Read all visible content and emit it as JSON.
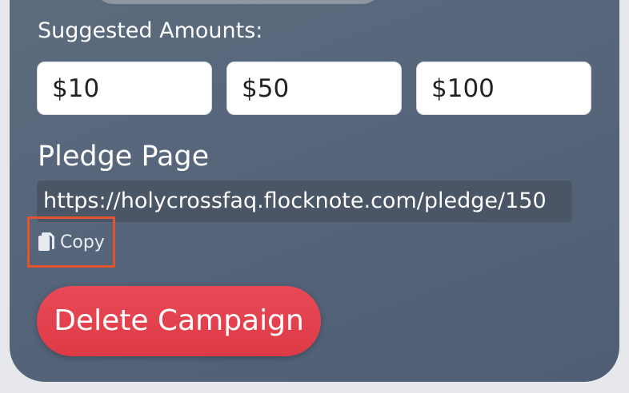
{
  "form": {
    "suggested_amounts_label": "Suggested Amounts:",
    "amounts": [
      "$10",
      "$50",
      "$100"
    ],
    "pledge_page_label": "Pledge Page",
    "pledge_url": "https://holycrossfaq.flocknote.com/pledge/150",
    "copy_label": "Copy",
    "copy_icon": "copy-icon",
    "delete_label": "Delete Campaign"
  },
  "colors": {
    "panel_bg": "#56657a",
    "delete_button": "#e0414d",
    "highlight_border": "#e1542f"
  }
}
